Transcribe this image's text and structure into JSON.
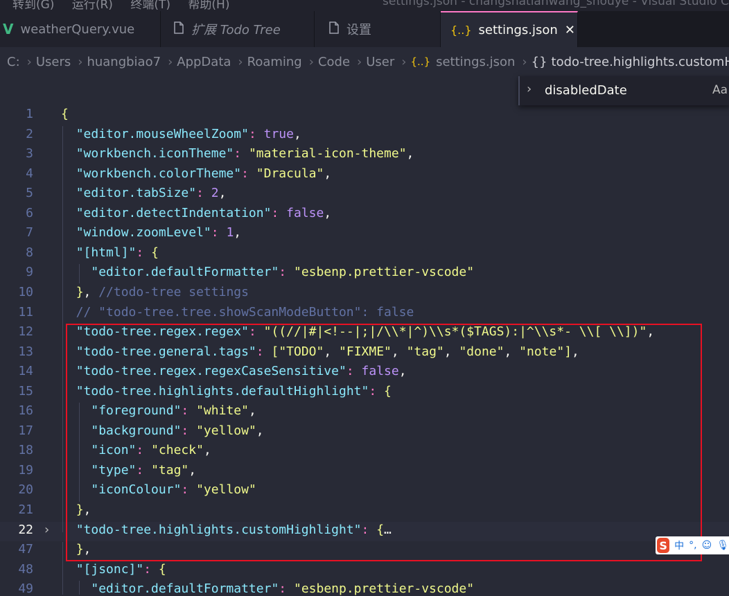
{
  "menu_bar": {
    "items": [
      "转到(G)",
      "运行(R)",
      "终端(T)",
      "帮助(H)"
    ],
    "window_title": "settings.json - changshatianwang_shouye - Visual Studio Code"
  },
  "tabs": [
    {
      "label": "weatherQuery.vue",
      "icon": "vue-icon"
    },
    {
      "label": "扩展 Todo Tree",
      "icon": "file-icon"
    },
    {
      "label": "设置",
      "icon": "file-icon"
    },
    {
      "label": "settings.json",
      "icon": "json-icon",
      "active": true
    }
  ],
  "tab_close_glyph": "✕",
  "breadcrumb": [
    "C:",
    "Users",
    "huangbiao7",
    "AppData",
    "Roaming",
    "Code",
    "User",
    "settings.json",
    "todo-tree.highlights.customHighlight"
  ],
  "find_widget": {
    "value": "disabledDate",
    "match_case_label": "Aa"
  },
  "editor_lines": [
    {
      "n": "1",
      "code": "{"
    },
    {
      "n": "2",
      "code": "  \"editor.mouseWheelZoom\": true,"
    },
    {
      "n": "3",
      "code": "  \"workbench.iconTheme\": \"material-icon-theme\","
    },
    {
      "n": "4",
      "code": "  \"workbench.colorTheme\": \"Dracula\","
    },
    {
      "n": "5",
      "code": "  \"editor.tabSize\": 2,"
    },
    {
      "n": "6",
      "code": "  \"editor.detectIndentation\": false,"
    },
    {
      "n": "7",
      "code": "  \"window.zoomLevel\": 1,"
    },
    {
      "n": "8",
      "code": "  \"[html]\": {"
    },
    {
      "n": "9",
      "code": "    \"editor.defaultFormatter\": \"esbenp.prettier-vscode\""
    },
    {
      "n": "10",
      "code": "  }, //todo-tree settings"
    },
    {
      "n": "11",
      "code": "  // \"todo-tree.tree.showScanModeButton\": false"
    },
    {
      "n": "12",
      "code": "  \"todo-tree.regex.regex\": \"((//|#|<!--|;|/\\\\*|^)\\\\s*($TAGS):|^\\\\s*- \\\\[ \\\\])\","
    },
    {
      "n": "13",
      "code": "  \"todo-tree.general.tags\": [\"TODO\", \"FIXME\", \"tag\", \"done\", \"note\"],"
    },
    {
      "n": "14",
      "code": "  \"todo-tree.regex.regexCaseSensitive\": false,"
    },
    {
      "n": "15",
      "code": "  \"todo-tree.highlights.defaultHighlight\": {"
    },
    {
      "n": "16",
      "code": "    \"foreground\": \"white\","
    },
    {
      "n": "17",
      "code": "    \"background\": \"yellow\","
    },
    {
      "n": "18",
      "code": "    \"icon\": \"check\","
    },
    {
      "n": "19",
      "code": "    \"type\": \"tag\","
    },
    {
      "n": "20",
      "code": "    \"iconColour\": \"yellow\""
    },
    {
      "n": "21",
      "code": "  },"
    },
    {
      "n": "22",
      "code": "  \"todo-tree.highlights.customHighlight\": {…",
      "folded": true,
      "current": true
    },
    {
      "n": "47",
      "code": "  },"
    },
    {
      "n": "48",
      "code": "  \"[jsonc]\": {"
    },
    {
      "n": "49",
      "code": "    \"editor.defaultFormatter\": \"esbenp.prettier-vscode\""
    }
  ],
  "ime_toolbar": {
    "logo": "S",
    "lang": "中",
    "punct": "°,",
    "emoji": "☺",
    "mic": "🎙"
  },
  "colors": {
    "editor_bg": "#282a36",
    "tab_bar_bg": "#191a21",
    "key": "#8be9fd",
    "string": "#f1fa8c",
    "keyword": "#ff79c6",
    "number_bool": "#bd93f9",
    "comment": "#6272a4",
    "line_number": "#6272a4",
    "annotation_box": "#e81123",
    "active_tab_border": "#ff79c6"
  }
}
